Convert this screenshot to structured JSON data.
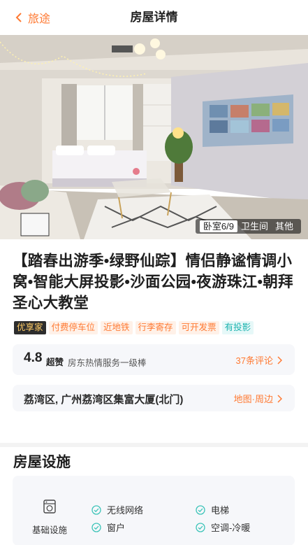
{
  "nav": {
    "back_label": "旅途",
    "title": "房屋详情"
  },
  "gallery": {
    "tabs": [
      "卧室6/9",
      "卫生间",
      "其他"
    ],
    "active_tab": "卧室6/9"
  },
  "listing": {
    "title": "【踏春出游季•绿野仙踪】情侣静谧情调小窝•智能大屏投影•沙面公园•夜游珠江•朝拜圣心大教堂",
    "tags": [
      "优享家",
      "付费停车位",
      "近地铁",
      "行李寄存",
      "可开发票",
      "有投影"
    ]
  },
  "rating": {
    "score": "4.8",
    "score_word": "超赞",
    "description": "房东热情服务一级棒",
    "reviews_link": "37条评论"
  },
  "location": {
    "address": "荔湾区, 广州荔湾区集富大厦(北门)",
    "map_link": "地图·周边"
  },
  "facilities": {
    "section_title": "房屋设施",
    "category_label": "基础设施",
    "items": [
      "无线网络",
      "电梯",
      "窗户",
      "空调-冷暖"
    ]
  },
  "colors": {
    "accent": "#ff7a33",
    "check": "#3cc4b8",
    "premium_tag_bg": "#2d2d2d"
  }
}
